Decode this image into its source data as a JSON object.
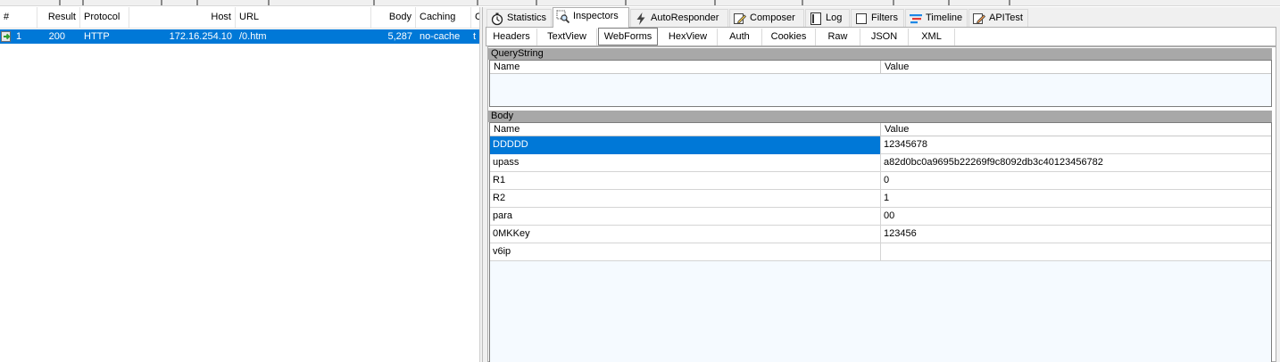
{
  "sessions": {
    "columns": [
      "#",
      "Result",
      "Protocol",
      "Host",
      "URL",
      "Body",
      "Caching",
      "C"
    ],
    "rows": [
      {
        "num": "1",
        "result": "200",
        "protocol": "HTTP",
        "host": "172.16.254.10",
        "url": "/0.htm",
        "body": "5,287",
        "caching": "no-cache",
        "extra": "t"
      }
    ]
  },
  "inspector": {
    "main_tabs": [
      "Statistics",
      "Inspectors",
      "AutoResponder",
      "Composer",
      "Log",
      "Filters",
      "Timeline",
      "APITest"
    ],
    "active_main_tab": "Inspectors",
    "sub_tabs": [
      "Headers",
      "TextView",
      "WebForms",
      "HexView",
      "Auth",
      "Cookies",
      "Raw",
      "JSON",
      "XML"
    ],
    "active_sub_tab": "WebForms",
    "querystring": {
      "title": "QueryString",
      "columns": [
        "Name",
        "Value"
      ]
    },
    "body": {
      "title": "Body",
      "columns": [
        "Name",
        "Value"
      ],
      "rows": [
        {
          "name": "DDDDD",
          "value": "12345678"
        },
        {
          "name": "upass",
          "value": "a82d0bc0a9695b22269f9c8092db3c40123456782"
        },
        {
          "name": "R1",
          "value": "0"
        },
        {
          "name": "R2",
          "value": "1"
        },
        {
          "name": "para",
          "value": "00"
        },
        {
          "name": "0MKKey",
          "value": "123456"
        },
        {
          "name": "v6ip",
          "value": ""
        }
      ]
    }
  },
  "colors": {
    "selection": "#0078d7",
    "section_header": "#a8a8a8",
    "grid_background": "#f5faff"
  },
  "icons": {
    "statistics": "stopwatch-icon",
    "inspectors": "magnifier-icon",
    "autoresponder": "lightning-icon",
    "composer": "pencil-icon",
    "log": "log-icon",
    "filters": "checkbox-icon",
    "timeline": "timeline-icon",
    "apitest": "apitest-icon",
    "session": "session-arrow-icon"
  }
}
